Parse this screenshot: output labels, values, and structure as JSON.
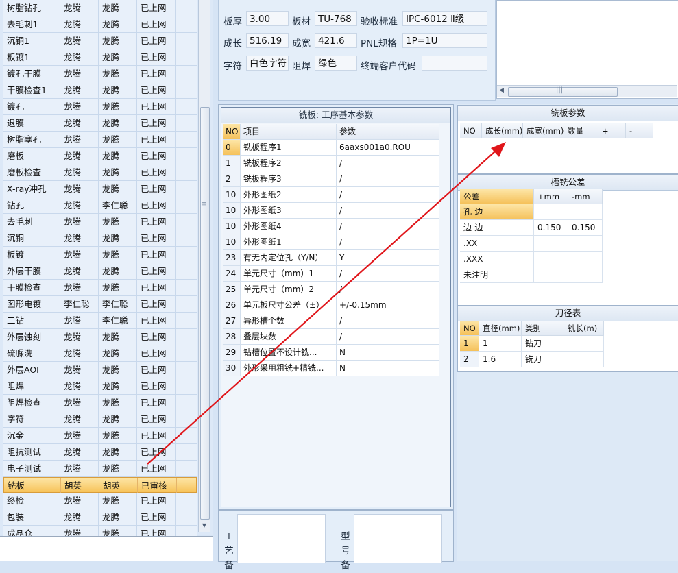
{
  "process_list": {
    "rows": [
      {
        "name": "树脂钻孔",
        "op1": "龙腾",
        "op2": "龙腾",
        "status": "已上网",
        "selected": false
      },
      {
        "name": "去毛刺1",
        "op1": "龙腾",
        "op2": "龙腾",
        "status": "已上网",
        "selected": false
      },
      {
        "name": "沉铜1",
        "op1": "龙腾",
        "op2": "龙腾",
        "status": "已上网",
        "selected": false
      },
      {
        "name": "板镀1",
        "op1": "龙腾",
        "op2": "龙腾",
        "status": "已上网",
        "selected": false
      },
      {
        "name": "镀孔干膜",
        "op1": "龙腾",
        "op2": "龙腾",
        "status": "已上网",
        "selected": false
      },
      {
        "name": "干膜检查1",
        "op1": "龙腾",
        "op2": "龙腾",
        "status": "已上网",
        "selected": false
      },
      {
        "name": "镀孔",
        "op1": "龙腾",
        "op2": "龙腾",
        "status": "已上网",
        "selected": false
      },
      {
        "name": "退膜",
        "op1": "龙腾",
        "op2": "龙腾",
        "status": "已上网",
        "selected": false
      },
      {
        "name": "树脂塞孔",
        "op1": "龙腾",
        "op2": "龙腾",
        "status": "已上网",
        "selected": false
      },
      {
        "name": "磨板",
        "op1": "龙腾",
        "op2": "龙腾",
        "status": "已上网",
        "selected": false
      },
      {
        "name": "磨板检查",
        "op1": "龙腾",
        "op2": "龙腾",
        "status": "已上网",
        "selected": false
      },
      {
        "name": "X-ray冲孔",
        "op1": "龙腾",
        "op2": "龙腾",
        "status": "已上网",
        "selected": false
      },
      {
        "name": "钻孔",
        "op1": "龙腾",
        "op2": "李仁聪",
        "status": "已上网",
        "selected": false
      },
      {
        "name": "去毛刺",
        "op1": "龙腾",
        "op2": "龙腾",
        "status": "已上网",
        "selected": false
      },
      {
        "name": "沉铜",
        "op1": "龙腾",
        "op2": "龙腾",
        "status": "已上网",
        "selected": false
      },
      {
        "name": "板镀",
        "op1": "龙腾",
        "op2": "龙腾",
        "status": "已上网",
        "selected": false
      },
      {
        "name": "外层干膜",
        "op1": "龙腾",
        "op2": "龙腾",
        "status": "已上网",
        "selected": false
      },
      {
        "name": "干膜检查",
        "op1": "龙腾",
        "op2": "龙腾",
        "status": "已上网",
        "selected": false
      },
      {
        "name": "图形电镀",
        "op1": "李仁聪",
        "op2": "李仁聪",
        "status": "已上网",
        "selected": false
      },
      {
        "name": "二钻",
        "op1": "龙腾",
        "op2": "李仁聪",
        "status": "已上网",
        "selected": false
      },
      {
        "name": "外层蚀刻",
        "op1": "龙腾",
        "op2": "龙腾",
        "status": "已上网",
        "selected": false
      },
      {
        "name": "硫脲洗",
        "op1": "龙腾",
        "op2": "龙腾",
        "status": "已上网",
        "selected": false
      },
      {
        "name": "外层AOI",
        "op1": "龙腾",
        "op2": "龙腾",
        "status": "已上网",
        "selected": false
      },
      {
        "name": "阻焊",
        "op1": "龙腾",
        "op2": "龙腾",
        "status": "已上网",
        "selected": false
      },
      {
        "name": "阻焊检查",
        "op1": "龙腾",
        "op2": "龙腾",
        "status": "已上网",
        "selected": false
      },
      {
        "name": "字符",
        "op1": "龙腾",
        "op2": "龙腾",
        "status": "已上网",
        "selected": false
      },
      {
        "name": "沉金",
        "op1": "龙腾",
        "op2": "龙腾",
        "status": "已上网",
        "selected": false
      },
      {
        "name": "阻抗测试",
        "op1": "龙腾",
        "op2": "龙腾",
        "status": "已上网",
        "selected": false
      },
      {
        "name": "电子测试",
        "op1": "龙腾",
        "op2": "龙腾",
        "status": "已上网",
        "selected": false
      },
      {
        "name": "铣板",
        "op1": "胡英",
        "op2": "胡英",
        "status": "已审核",
        "selected": true
      },
      {
        "name": "终检",
        "op1": "龙腾",
        "op2": "龙腾",
        "status": "已上网",
        "selected": false
      },
      {
        "name": "包装",
        "op1": "龙腾",
        "op2": "龙腾",
        "status": "已上网",
        "selected": false
      },
      {
        "name": "成品仓",
        "op1": "龙腾",
        "op2": "龙腾",
        "status": "已上网",
        "selected": false
      }
    ]
  },
  "top_info": {
    "board_thickness_label": "板厚",
    "board_thickness": "3.00",
    "material_label": "板材",
    "material": "TU-768",
    "standard_label": "验收标准",
    "standard": "IPC-6012 Ⅱ级",
    "length_label": "成长",
    "length": "516.19",
    "width_label": "成宽",
    "width": "421.6",
    "pnl_label": "PNL规格",
    "pnl": "1P=1U",
    "legend_label": "字符",
    "legend": "白色字符",
    "mask_label": "阻焊",
    "mask": "绿色",
    "customer_code_label": "终端客户代码",
    "customer_code": ""
  },
  "milling_panel": {
    "title": "铣板: 工序基本参数",
    "headers": {
      "no": "NO",
      "item": "项目",
      "param": "参数"
    },
    "rows": [
      {
        "no": "0",
        "item": "铣板程序1",
        "param": "6aaxs001a0.ROU",
        "current": true
      },
      {
        "no": "1",
        "item": "铣板程序2",
        "param": "/",
        "current": false
      },
      {
        "no": "2",
        "item": "铣板程序3",
        "param": "/",
        "current": false
      },
      {
        "no": "10",
        "item": "外形图纸2",
        "param": "/",
        "current": false
      },
      {
        "no": "10",
        "item": "外形图纸3",
        "param": "/",
        "current": false
      },
      {
        "no": "10",
        "item": "外形图纸4",
        "param": "/",
        "current": false
      },
      {
        "no": "10",
        "item": "外形图纸1",
        "param": "/",
        "current": false
      },
      {
        "no": "23",
        "item": "有无内定位孔（Y/N）",
        "param": "Y",
        "current": false
      },
      {
        "no": "24",
        "item": "单元尺寸（mm）1",
        "param": "/",
        "current": false
      },
      {
        "no": "25",
        "item": "单元尺寸（mm）2",
        "param": "/",
        "current": false
      },
      {
        "no": "26",
        "item": "单元板尺寸公差（±）",
        "param": "+/-0.15mm",
        "current": false
      },
      {
        "no": "27",
        "item": "异形槽个数",
        "param": "/",
        "current": false
      },
      {
        "no": "28",
        "item": "叠层块数",
        "param": "/",
        "current": false
      },
      {
        "no": "29",
        "item": "钻槽位置不设计铣...",
        "param": "N",
        "current": false
      },
      {
        "no": "30",
        "item": "外形采用粗铣+精铣...",
        "param": "N",
        "current": false
      }
    ]
  },
  "bottom_area": {
    "process_label": "工艺备",
    "model_label": "型号备"
  },
  "milling_board_params": {
    "title": "铣板参数",
    "headers": [
      "NO",
      "成长(mm)",
      "成宽(mm)",
      "数量",
      "+",
      "-"
    ]
  },
  "slot_tolerance": {
    "title": "槽铣公差",
    "headers": [
      "公差",
      "+mm",
      "-mm"
    ],
    "rows": [
      {
        "name": "孔-边",
        "plus": "",
        "minus": ""
      },
      {
        "name": "边-边",
        "plus": "0.150",
        "minus": "0.150"
      },
      {
        "name": ".XX",
        "plus": "",
        "minus": ""
      },
      {
        "name": ".XXX",
        "plus": "",
        "minus": ""
      },
      {
        "name": "未注明",
        "plus": "",
        "minus": ""
      }
    ]
  },
  "tool_table": {
    "title": "刀径表",
    "headers": [
      "NO",
      "直径(mm)",
      "类别",
      "铣长(m)"
    ],
    "rows": [
      {
        "no": "1",
        "diameter": "1",
        "type": "钻刀",
        "length": ""
      },
      {
        "no": "2",
        "diameter": "1.6",
        "type": "铣刀",
        "length": ""
      }
    ]
  },
  "annotation_arrow": {
    "color": "#e0151a"
  }
}
